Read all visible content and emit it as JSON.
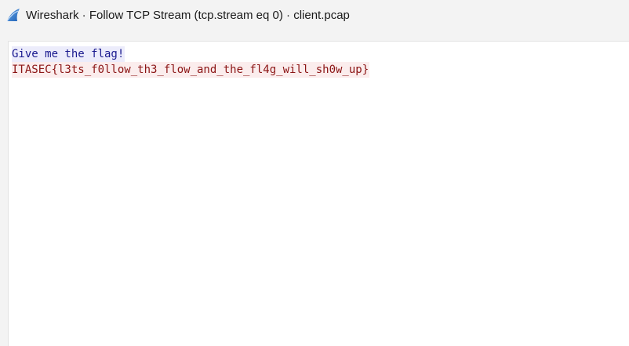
{
  "window": {
    "title": "Wireshark · Follow TCP Stream (tcp.stream eq 0) · client.pcap",
    "icon": "wireshark-fin-icon"
  },
  "stream": {
    "lines": [
      {
        "direction": "client",
        "text": "Give me the flag!",
        "color": "#1a1a8f",
        "background": "#ececfb"
      },
      {
        "direction": "server",
        "text": "ITASEC{l3ts_f0llow_th3_flow_and_the_fl4g_will_sh0w_up}",
        "color": "#8b1414",
        "background": "#fbeded"
      }
    ]
  }
}
